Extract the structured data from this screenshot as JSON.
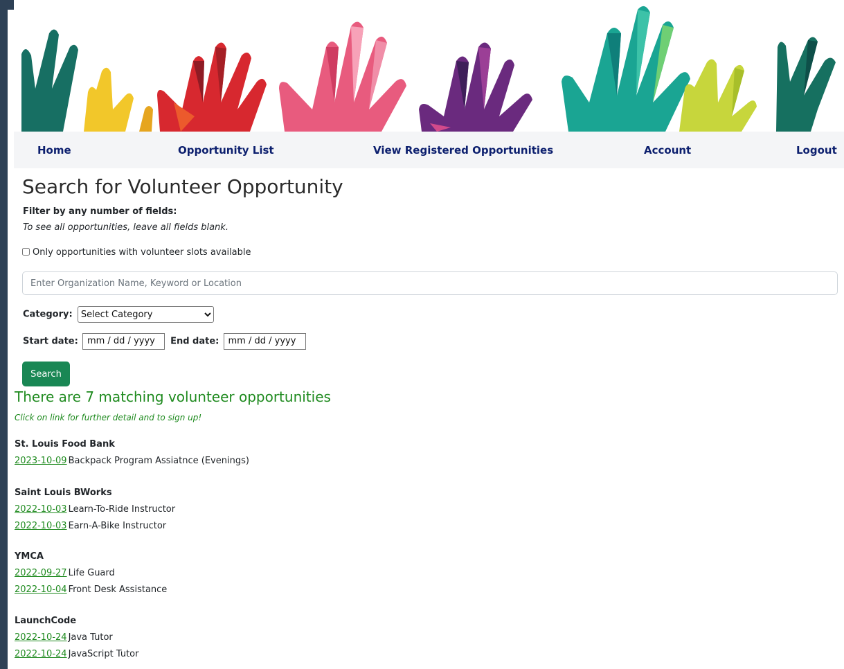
{
  "nav": {
    "items": [
      {
        "label": "Home"
      },
      {
        "label": "Opportunity List"
      },
      {
        "label": "View Registered Opportunities"
      },
      {
        "label": "Account"
      },
      {
        "label": "Logout"
      }
    ]
  },
  "search": {
    "title": "Search for Volunteer Opportunity",
    "filter_heading": "Filter by any number of fields:",
    "filter_note": "To see all opportunities, leave all fields blank.",
    "slots_label": "Only opportunities with volunteer slots available",
    "keyword_placeholder": "Enter Organization Name, Keyword or Location",
    "category_label": "Category:",
    "category_selected": "Select Category",
    "start_label": "Start date:",
    "start_value": "mm / dd / yyyy",
    "end_label": "End date:",
    "end_value": "mm / dd / yyyy",
    "button_label": "Search"
  },
  "results": {
    "summary": "There are 7 matching volunteer opportunities",
    "note": "Click on link for further detail and to sign up!",
    "organizations": [
      {
        "name": "St. Louis Food Bank",
        "opportunities": [
          {
            "date": "2023-10-09",
            "title": "Backpack Program Assiatnce (Evenings)"
          }
        ]
      },
      {
        "name": "Saint Louis BWorks",
        "opportunities": [
          {
            "date": "2022-10-03",
            "title": "Learn-To-Ride Instructor"
          },
          {
            "date": "2022-10-03",
            "title": "Earn-A-Bike Instructor"
          }
        ]
      },
      {
        "name": "YMCA",
        "opportunities": [
          {
            "date": "2022-09-27",
            "title": "Life Guard"
          },
          {
            "date": "2022-10-04",
            "title": "Front Desk Assistance"
          }
        ]
      },
      {
        "name": "LaunchCode",
        "opportunities": [
          {
            "date": "2022-10-24",
            "title": "Java Tutor"
          },
          {
            "date": "2022-10-24",
            "title": "JavaScript Tutor"
          }
        ]
      }
    ]
  },
  "colors": {
    "nav_text": "#0c1f6e",
    "button": "#198754",
    "result_green": "#1e8a1e"
  }
}
